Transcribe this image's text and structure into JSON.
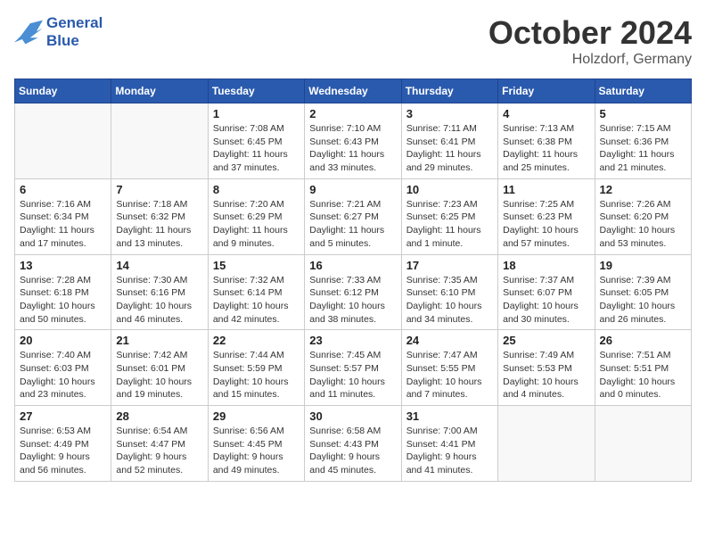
{
  "header": {
    "logo_line1": "General",
    "logo_line2": "Blue",
    "month": "October 2024",
    "location": "Holzdorf, Germany"
  },
  "weekdays": [
    "Sunday",
    "Monday",
    "Tuesday",
    "Wednesday",
    "Thursday",
    "Friday",
    "Saturday"
  ],
  "weeks": [
    [
      {
        "day": "",
        "info": ""
      },
      {
        "day": "",
        "info": ""
      },
      {
        "day": "1",
        "info": "Sunrise: 7:08 AM\nSunset: 6:45 PM\nDaylight: 11 hours and 37 minutes."
      },
      {
        "day": "2",
        "info": "Sunrise: 7:10 AM\nSunset: 6:43 PM\nDaylight: 11 hours and 33 minutes."
      },
      {
        "day": "3",
        "info": "Sunrise: 7:11 AM\nSunset: 6:41 PM\nDaylight: 11 hours and 29 minutes."
      },
      {
        "day": "4",
        "info": "Sunrise: 7:13 AM\nSunset: 6:38 PM\nDaylight: 11 hours and 25 minutes."
      },
      {
        "day": "5",
        "info": "Sunrise: 7:15 AM\nSunset: 6:36 PM\nDaylight: 11 hours and 21 minutes."
      }
    ],
    [
      {
        "day": "6",
        "info": "Sunrise: 7:16 AM\nSunset: 6:34 PM\nDaylight: 11 hours and 17 minutes."
      },
      {
        "day": "7",
        "info": "Sunrise: 7:18 AM\nSunset: 6:32 PM\nDaylight: 11 hours and 13 minutes."
      },
      {
        "day": "8",
        "info": "Sunrise: 7:20 AM\nSunset: 6:29 PM\nDaylight: 11 hours and 9 minutes."
      },
      {
        "day": "9",
        "info": "Sunrise: 7:21 AM\nSunset: 6:27 PM\nDaylight: 11 hours and 5 minutes."
      },
      {
        "day": "10",
        "info": "Sunrise: 7:23 AM\nSunset: 6:25 PM\nDaylight: 11 hours and 1 minute."
      },
      {
        "day": "11",
        "info": "Sunrise: 7:25 AM\nSunset: 6:23 PM\nDaylight: 10 hours and 57 minutes."
      },
      {
        "day": "12",
        "info": "Sunrise: 7:26 AM\nSunset: 6:20 PM\nDaylight: 10 hours and 53 minutes."
      }
    ],
    [
      {
        "day": "13",
        "info": "Sunrise: 7:28 AM\nSunset: 6:18 PM\nDaylight: 10 hours and 50 minutes."
      },
      {
        "day": "14",
        "info": "Sunrise: 7:30 AM\nSunset: 6:16 PM\nDaylight: 10 hours and 46 minutes."
      },
      {
        "day": "15",
        "info": "Sunrise: 7:32 AM\nSunset: 6:14 PM\nDaylight: 10 hours and 42 minutes."
      },
      {
        "day": "16",
        "info": "Sunrise: 7:33 AM\nSunset: 6:12 PM\nDaylight: 10 hours and 38 minutes."
      },
      {
        "day": "17",
        "info": "Sunrise: 7:35 AM\nSunset: 6:10 PM\nDaylight: 10 hours and 34 minutes."
      },
      {
        "day": "18",
        "info": "Sunrise: 7:37 AM\nSunset: 6:07 PM\nDaylight: 10 hours and 30 minutes."
      },
      {
        "day": "19",
        "info": "Sunrise: 7:39 AM\nSunset: 6:05 PM\nDaylight: 10 hours and 26 minutes."
      }
    ],
    [
      {
        "day": "20",
        "info": "Sunrise: 7:40 AM\nSunset: 6:03 PM\nDaylight: 10 hours and 23 minutes."
      },
      {
        "day": "21",
        "info": "Sunrise: 7:42 AM\nSunset: 6:01 PM\nDaylight: 10 hours and 19 minutes."
      },
      {
        "day": "22",
        "info": "Sunrise: 7:44 AM\nSunset: 5:59 PM\nDaylight: 10 hours and 15 minutes."
      },
      {
        "day": "23",
        "info": "Sunrise: 7:45 AM\nSunset: 5:57 PM\nDaylight: 10 hours and 11 minutes."
      },
      {
        "day": "24",
        "info": "Sunrise: 7:47 AM\nSunset: 5:55 PM\nDaylight: 10 hours and 7 minutes."
      },
      {
        "day": "25",
        "info": "Sunrise: 7:49 AM\nSunset: 5:53 PM\nDaylight: 10 hours and 4 minutes."
      },
      {
        "day": "26",
        "info": "Sunrise: 7:51 AM\nSunset: 5:51 PM\nDaylight: 10 hours and 0 minutes."
      }
    ],
    [
      {
        "day": "27",
        "info": "Sunrise: 6:53 AM\nSunset: 4:49 PM\nDaylight: 9 hours and 56 minutes."
      },
      {
        "day": "28",
        "info": "Sunrise: 6:54 AM\nSunset: 4:47 PM\nDaylight: 9 hours and 52 minutes."
      },
      {
        "day": "29",
        "info": "Sunrise: 6:56 AM\nSunset: 4:45 PM\nDaylight: 9 hours and 49 minutes."
      },
      {
        "day": "30",
        "info": "Sunrise: 6:58 AM\nSunset: 4:43 PM\nDaylight: 9 hours and 45 minutes."
      },
      {
        "day": "31",
        "info": "Sunrise: 7:00 AM\nSunset: 4:41 PM\nDaylight: 9 hours and 41 minutes."
      },
      {
        "day": "",
        "info": ""
      },
      {
        "day": "",
        "info": ""
      }
    ]
  ]
}
